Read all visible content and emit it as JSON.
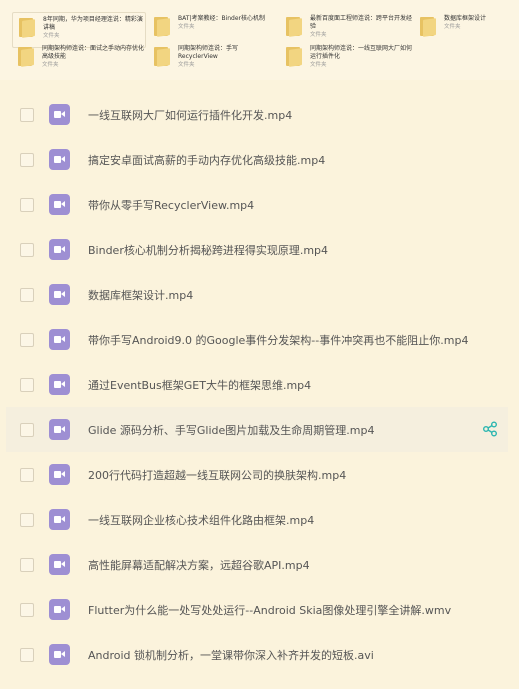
{
  "folders": [
    {
      "title": "8年同期，华为项目经理连说：精彩演讲稿",
      "sub": "文件夹",
      "selected": true
    },
    {
      "title": "BAT|考案教经：Binder核心机制",
      "sub": "文件夹",
      "selected": false
    },
    {
      "title": "最新百度面工程师连说：跨平台开发经验",
      "sub": "文件夹",
      "selected": false
    },
    {
      "title": "数据库框架设计",
      "sub": "文件夹",
      "selected": false
    },
    {
      "title": "同期架构师连说：面试之手动内存优化高级技能",
      "sub": "文件夹",
      "selected": false
    },
    {
      "title": "同期架构师连说：手写RecyclerView",
      "sub": "文件夹",
      "selected": false
    },
    {
      "title": "同期架构师连说：一线互联网大厂如何运行插件化",
      "sub": "文件夹",
      "selected": false
    }
  ],
  "files": [
    {
      "name": "一线互联网大厂如何运行插件化开发.mp4"
    },
    {
      "name": "搞定安卓面试高薪的手动内存优化高级技能.mp4"
    },
    {
      "name": "带你从零手写RecyclerView.mp4"
    },
    {
      "name": "Binder核心机制分析揭秘跨进程得实现原理.mp4"
    },
    {
      "name": "数据库框架设计.mp4"
    },
    {
      "name": "带你手写Android9.0 的Google事件分发架构--事件冲突再也不能阻止你.mp4"
    },
    {
      "name": "通过EventBus框架GET大牛的框架思维.mp4"
    },
    {
      "name": "Glide 源码分析、手写Glide图片加载及生命周期管理.mp4"
    },
    {
      "name": "200行代码打造超越一线互联网公司的换肤架构.mp4"
    },
    {
      "name": "一线互联网企业核心技术组件化路由框架.mp4"
    },
    {
      "name": "高性能屏幕适配解决方案，远超谷歌API.mp4"
    },
    {
      "name": "Flutter为什么能一处写处处运行--Android Skia图像处理引擎全讲解.wmv"
    },
    {
      "name": "Android 锁机制分析，一堂课带你深入补齐并发的短板.avi"
    }
  ],
  "highlighted_index": 7,
  "colors": {
    "background": "#fbf3dc",
    "video_icon": "#9e8fd3",
    "share_icon": "#2bb6b0",
    "folder": "#e7c262"
  },
  "icons": {
    "file_icon": "video-file-icon",
    "row_action": "share-icon",
    "folder_icon": "folder-icon"
  }
}
